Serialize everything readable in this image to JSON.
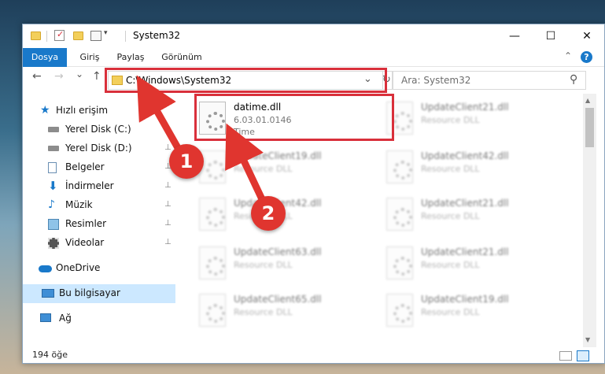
{
  "window": {
    "title": "System32",
    "minimize": "—",
    "maximize": "☐",
    "close": "✕"
  },
  "ribbon": {
    "tabs": [
      "Dosya",
      "Giriş",
      "Paylaş",
      "Görünüm"
    ],
    "collapse": "⌃",
    "help": "?"
  },
  "nav": {
    "back": "←",
    "forward": "→",
    "recent": "⌄",
    "up": "↑",
    "address": "C:\\Windows\\System32",
    "address_dropdown": "⌄",
    "refresh": "↻",
    "search_placeholder": "Ara: System32",
    "search_icon": "⚲"
  },
  "sidebar": {
    "items": [
      {
        "label": "Hızlı erişim",
        "icon": "star-icon"
      },
      {
        "label": "Yerel Disk (C:)",
        "icon": "drive-icon",
        "pin": "✕"
      },
      {
        "label": "Yerel Disk (D:)",
        "icon": "drive-icon",
        "pin": "📌"
      },
      {
        "label": "Belgeler",
        "icon": "documents-icon",
        "pin": "📌"
      },
      {
        "label": "İndirmeler",
        "icon": "downloads-icon",
        "pin": "📌"
      },
      {
        "label": "Müzik",
        "icon": "music-icon",
        "pin": "📌"
      },
      {
        "label": "Resimler",
        "icon": "pictures-icon",
        "pin": "📌"
      },
      {
        "label": "Videolar",
        "icon": "videos-icon",
        "pin": "📌"
      },
      {
        "label": "OneDrive",
        "icon": "cloud-icon"
      },
      {
        "label": "Bu bilgisayar",
        "icon": "computer-icon"
      },
      {
        "label": "Ağ",
        "icon": "network-icon"
      }
    ]
  },
  "files": [
    {
      "name": "datime.dll",
      "version": "6.03.01.0146",
      "desc": "Time"
    },
    {
      "name": "UpdateClient21.dll",
      "version": "",
      "desc": "Resource DLL"
    },
    {
      "name": "UpdateClient19.dll",
      "version": "",
      "desc": "Resource DLL"
    },
    {
      "name": "UpdateClient42.dll",
      "version": "",
      "desc": "Resource DLL"
    },
    {
      "name": "UpdateClient42.dll",
      "version": "",
      "desc": "Resource DLL"
    },
    {
      "name": "UpdateClient21.dll",
      "version": "",
      "desc": "Resource DLL"
    },
    {
      "name": "UpdateClient63.dll",
      "version": "",
      "desc": "Resource DLL"
    },
    {
      "name": "UpdateClient21.dll",
      "version": "",
      "desc": "Resource DLL"
    },
    {
      "name": "UpdateClient65.dll",
      "version": "",
      "desc": "Resource DLL"
    },
    {
      "name": "UpdateClient19.dll",
      "version": "",
      "desc": "Resource DLL"
    }
  ],
  "status": {
    "count": "194 öğe"
  },
  "callouts": [
    "1",
    "2"
  ],
  "colors": {
    "accent": "#1979ca",
    "highlight": "#d9303b",
    "callout": "#e0352f",
    "selected": "#cce8ff"
  }
}
